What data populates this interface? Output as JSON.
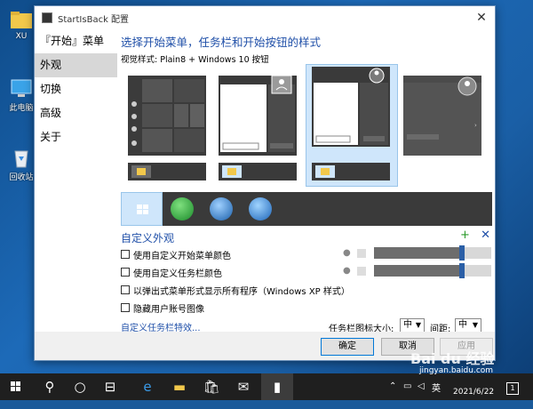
{
  "desktop": {
    "icons": [
      {
        "label": "XU"
      },
      {
        "label": "此电脑"
      },
      {
        "label": "回收站"
      }
    ]
  },
  "window": {
    "title": "StartIsBack 配置",
    "close": "✕"
  },
  "sidebar": {
    "items": [
      {
        "label": "『开始』菜单"
      },
      {
        "label": "外观"
      },
      {
        "label": "切换"
      },
      {
        "label": "高级"
      },
      {
        "label": "关于"
      }
    ]
  },
  "main": {
    "heading": "选择开始菜单，任务栏和开始按钮的样式",
    "visual_style": "视觉样式:   Plain8 + Windows 10 按钮",
    "custom_title": "自定义外观",
    "plus": "+",
    "remove": "✕",
    "options": [
      {
        "label": "使用自定义开始菜单颜色",
        "checked": false
      },
      {
        "label": "使用自定义任务栏颜色",
        "checked": false
      },
      {
        "label": "以弹出式菜单形式显示所有程序（Windows XP 样式）",
        "checked": false
      },
      {
        "label": "隐藏用户账号图像",
        "checked": false
      }
    ],
    "link": "自定义任务栏特效...",
    "icon_size_label": "任务栏图标大小:",
    "icon_size_value": "中",
    "spacing_label": "间距:",
    "spacing_value": "中"
  },
  "footer": {
    "ok": "确定",
    "cancel": "取消",
    "apply": "应用"
  },
  "taskbar": {
    "ime": "英",
    "date": "2021/6/22",
    "notification_count": "1"
  },
  "watermark": {
    "brand": "Bai du 经验",
    "url": "jingyan.baidu.com"
  },
  "colors": {
    "accent": "#1f4fa8",
    "selection": "#cfe6fb",
    "taskbar": "#1f1f1f"
  }
}
